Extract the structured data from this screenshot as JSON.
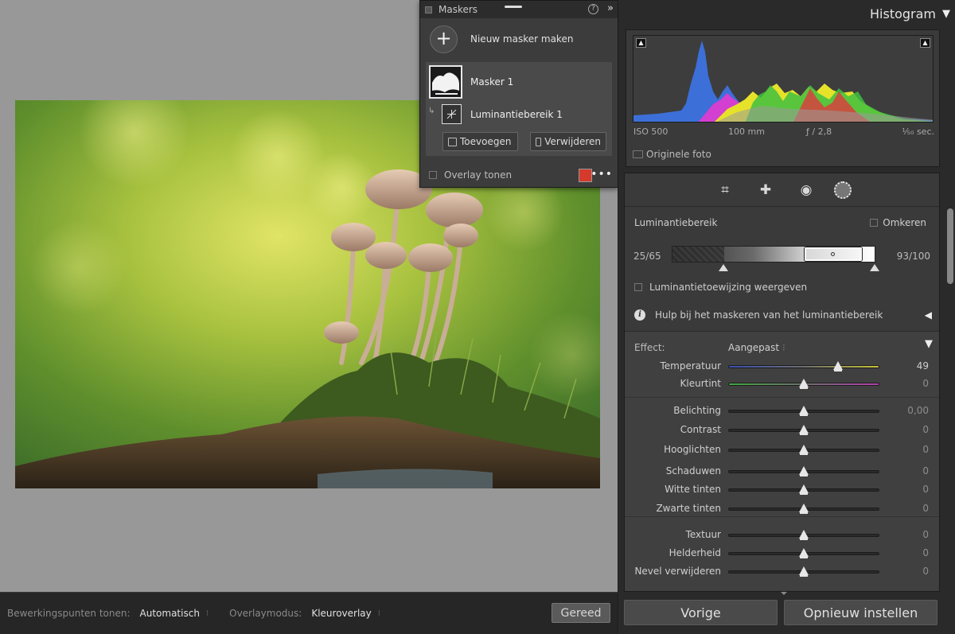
{
  "masks_panel": {
    "title": "Maskers",
    "new_mask_label": "Nieuw masker maken",
    "mask1_label": "Masker 1",
    "component_label": "Luminantiebereik 1",
    "add_label": "Toevoegen",
    "remove_label": "Verwijderen",
    "overlay_label": "Overlay tonen",
    "overlay_color": "#d53a2a"
  },
  "toolbar": {
    "edit_points_label": "Bewerkingspunten tonen:",
    "edit_points_value": "Automatisch",
    "overlay_mode_label": "Overlaymodus:",
    "overlay_mode_value": "Kleuroverlay",
    "done_label": "Gereed"
  },
  "histogram": {
    "title": "Histogram",
    "iso": "ISO 500",
    "focal": "100 mm",
    "aperture": "ƒ / 2,8",
    "shutter": "¹⁄₅₀ sec.",
    "original_photo_label": "Originele foto"
  },
  "luminance": {
    "title": "Luminantiebereik",
    "invert_label": "Omkeren",
    "left_value": "25/65",
    "right_value": "93/100",
    "show_mapping_label": "Luminantietoewijzing weergeven",
    "help_label": "Hulp bij het maskeren van het luminantiebereik"
  },
  "effect": {
    "label": "Effect:",
    "value": "Aangepast",
    "sliders": [
      {
        "name": "Temperatuur",
        "value": "49",
        "level": 0.73
      },
      {
        "name": "Kleurtint",
        "value": "0",
        "level": 0.5
      },
      {
        "name": "Belichting",
        "value": "0,00",
        "level": 0.5
      },
      {
        "name": "Contrast",
        "value": "0",
        "level": 0.5
      },
      {
        "name": "Hooglichten",
        "value": "0",
        "level": 0.5
      },
      {
        "name": "Schaduwen",
        "value": "0",
        "level": 0.5
      },
      {
        "name": "Witte tinten",
        "value": "0",
        "level": 0.5
      },
      {
        "name": "Zwarte tinten",
        "value": "0",
        "level": 0.5
      },
      {
        "name": "Textuur",
        "value": "0",
        "level": 0.5
      },
      {
        "name": "Helderheid",
        "value": "0",
        "level": 0.5
      },
      {
        "name": "Nevel verwijderen",
        "value": "0",
        "level": 0.5
      }
    ]
  },
  "bottom": {
    "prev_label": "Vorige",
    "reset_label": "Opnieuw instellen"
  }
}
